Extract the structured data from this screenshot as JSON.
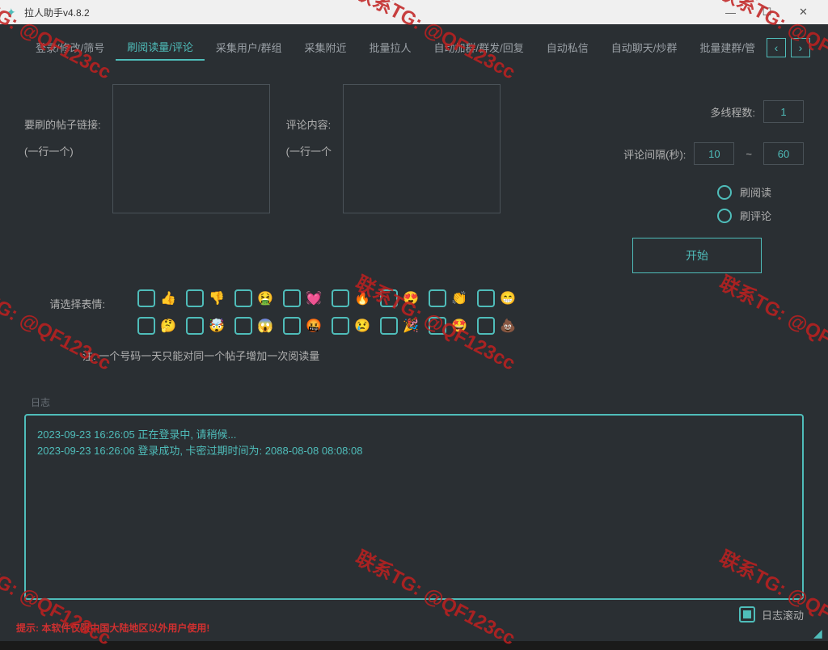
{
  "window": {
    "title": "拉人助手v4.8.2"
  },
  "tabs": {
    "items": [
      "登录/修改/筛号",
      "刷阅读量/评论",
      "采集用户/群组",
      "采集附近",
      "批量拉人",
      "自动加群/群发/回复",
      "自动私信",
      "自动聊天/炒群",
      "批量建群/管"
    ],
    "active_index": 1
  },
  "labels": {
    "post_link": "要刷的帖子链接:",
    "one_per_line": "(一行一个)",
    "comment_content": "评论内容:",
    "one_per_line2": "(一行一个",
    "select_emoji": "请选择表情:",
    "thread_count": "多线程数:",
    "comment_interval": "评论间隔(秒):",
    "interval_sep": "~"
  },
  "params": {
    "threads": "1",
    "interval_min": "10",
    "interval_max": "60"
  },
  "radios": {
    "brush_read": "刷阅读",
    "brush_comment": "刷评论"
  },
  "buttons": {
    "start": "开始"
  },
  "emojis": {
    "row1": [
      "👍",
      "👎",
      "🤮",
      "💓",
      "🔥",
      "😍",
      "👏",
      "😁"
    ],
    "row2": [
      "🤔",
      "🤯",
      "😱",
      "🤬",
      "😢",
      "🎉",
      "🤩",
      "💩"
    ]
  },
  "note": "注: 一个号码一天只能对同一个帖子增加一次阅读量",
  "log": {
    "label": "日志",
    "lines": [
      "2023-09-23 16:26:05 正在登录中, 请稍候...",
      "2023-09-23 16:26:06 登录成功, 卡密过期时间为: 2088-08-08 08:08:08"
    ],
    "scroll_label": "日志滚动"
  },
  "warning": "提示: 本软件仅限中国大陆地区以外用户使用!",
  "watermark": "联系TG: @QF123cc"
}
